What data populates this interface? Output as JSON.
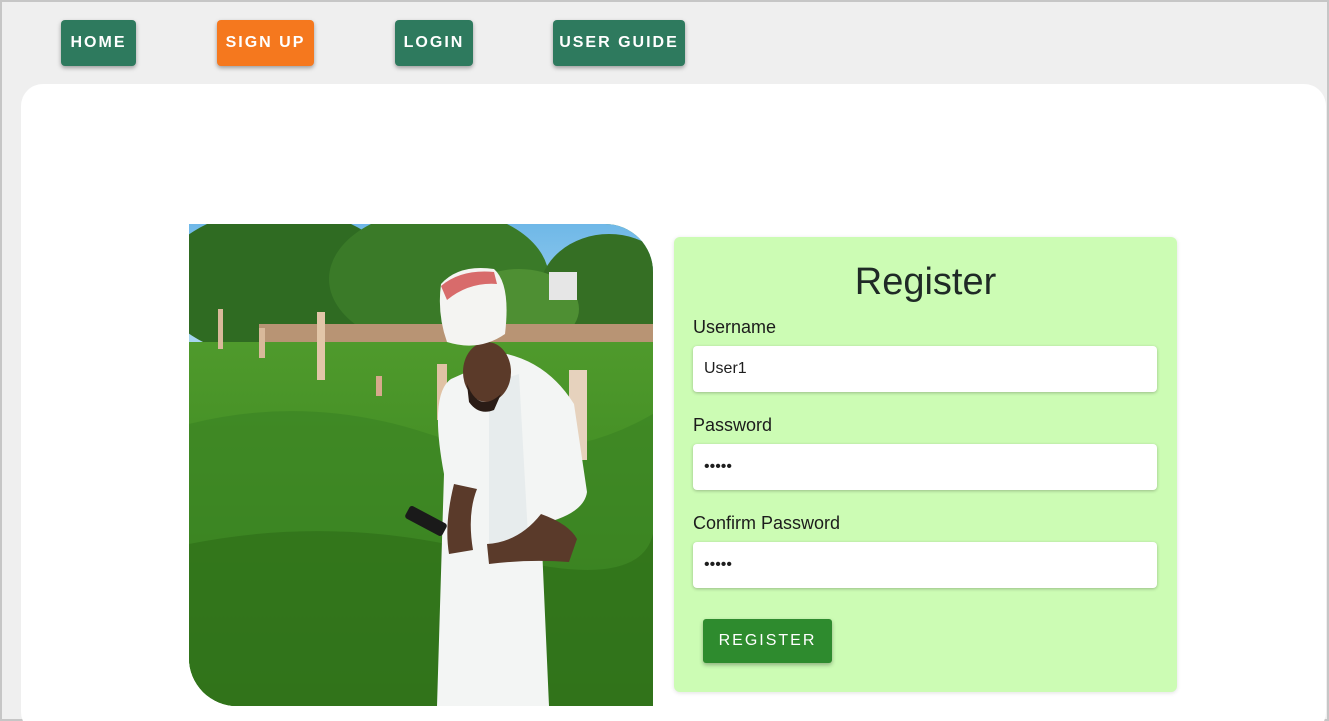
{
  "nav": {
    "home": "HOME",
    "signup": "SIGN UP",
    "login": "LOGIN",
    "user_guide": "USER GUIDE"
  },
  "colors": {
    "nav_default": "#2e7a5e",
    "nav_active": "#f5781e",
    "form_bg": "#ccfcb4",
    "register_button": "#2e8b2e"
  },
  "photo": {
    "icon": "farmer-photo"
  },
  "form": {
    "title": "Register",
    "username_label": "Username",
    "username_value": "User1",
    "password_label": "Password",
    "password_value": "•••••",
    "confirm_label": "Confirm Password",
    "confirm_value": "•••••",
    "register_button": "REGISTER"
  }
}
